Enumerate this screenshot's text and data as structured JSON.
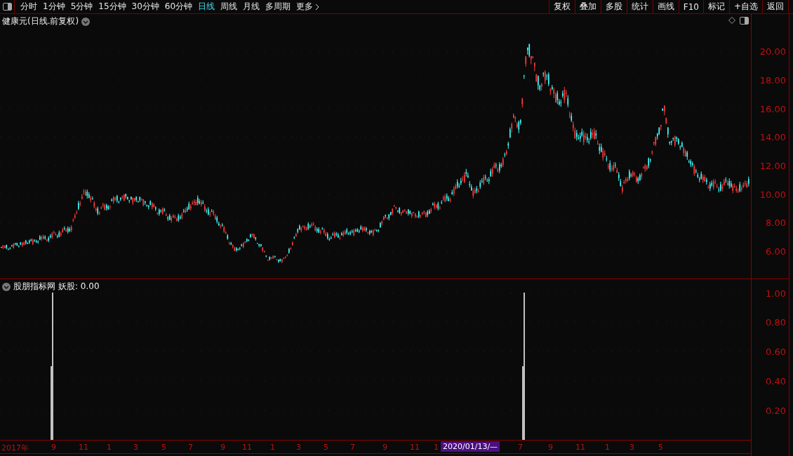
{
  "toolbar": {
    "periods": [
      {
        "label": "分时",
        "selected": false
      },
      {
        "label": "1分钟",
        "selected": false
      },
      {
        "label": "5分钟",
        "selected": false
      },
      {
        "label": "15分钟",
        "selected": false
      },
      {
        "label": "30分钟",
        "selected": false
      },
      {
        "label": "60分钟",
        "selected": false
      },
      {
        "label": "日线",
        "selected": true
      },
      {
        "label": "周线",
        "selected": false
      },
      {
        "label": "月线",
        "selected": false
      },
      {
        "label": "多周期",
        "selected": false
      }
    ],
    "more": "更多",
    "tools": [
      "复权",
      "叠加",
      "多股",
      "统计",
      "画线",
      "F10",
      "标记",
      "+自选",
      "返回"
    ]
  },
  "price_chart": {
    "title": "健康元(日线.前复权)",
    "axis_labels": [
      "20.00",
      "18.00",
      "16.00",
      "14.00",
      "12.00",
      "10.00",
      "8.00",
      "6.00"
    ]
  },
  "indicator": {
    "name": "股朋指标网",
    "value_label": "妖股: 0.00",
    "axis_labels": [
      "1.00",
      "0.80",
      "0.60",
      "0.40",
      "0.20"
    ]
  },
  "date_axis": {
    "labels": [
      "2017年",
      "9",
      "11",
      "1",
      "3",
      "5",
      "7",
      "9",
      "11",
      "1",
      "3",
      "5",
      "7",
      "9",
      "11",
      "1",
      "7",
      "9",
      "11",
      "1",
      "3",
      "5"
    ],
    "cursor_label": "2020/01/13/—"
  }
}
